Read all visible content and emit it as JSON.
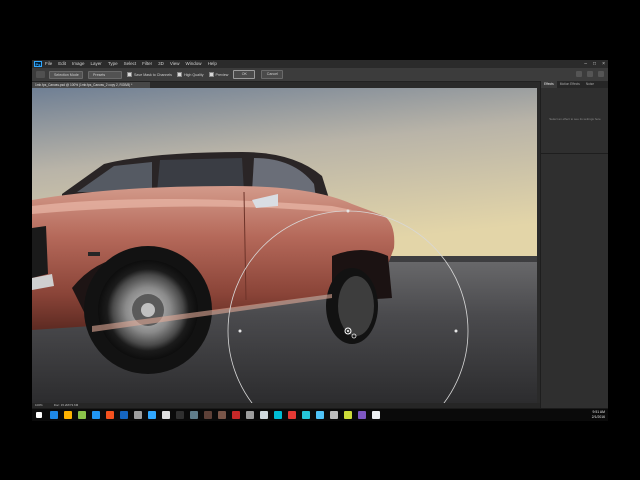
{
  "app": {
    "logo_text": "Ps",
    "menu": [
      "File",
      "Edit",
      "Image",
      "Layer",
      "Type",
      "Select",
      "Filter",
      "3D",
      "View",
      "Window",
      "Help"
    ],
    "window_controls": [
      "–",
      "□",
      "×"
    ]
  },
  "options_bar": {
    "selection_mode": "Selection Mode",
    "preset": "Presets",
    "save_mask_label": "Save Mask to Channels",
    "high_quality_label": "High Quality",
    "preview_label": "Preview",
    "ok_label": "OK",
    "cancel_label": "Cancel"
  },
  "document": {
    "tab_label": "1mb.fps_Canvas.psd @ 100% (1mb.fps_Canvas_2 copy 2, RGB/8) *",
    "zoom": "100%",
    "doc_size": "Doc: 15.2M/73.6M"
  },
  "panel": {
    "tabs": [
      "Effects",
      "Motion Effects",
      "Noise"
    ],
    "message": "Select an effect to see its settings here"
  },
  "taskbar": {
    "time": "9:51 AM",
    "date": "2/1/2016",
    "icon_colors": [
      "#1e88e5",
      "#ffb300",
      "#8bc34a",
      "#2196f3",
      "#f4511e",
      "#1565c0",
      "#9e9e9e",
      "#31a8ff",
      "#e0e0e0",
      "#2f2f2f",
      "#607d8b",
      "#5d4037",
      "#795548",
      "#c62828",
      "#9e9e9e",
      "#cfd8dc",
      "#00bcd4",
      "#e53935",
      "#26c6da",
      "#4fc3f7",
      "#bdbdbd",
      "#cddc39",
      "#7e57c2",
      "#eceff1"
    ]
  },
  "colors": {
    "car_body": "#b56657",
    "sky_top": "#7d8796",
    "sky_bottom": "#dccfa4",
    "ground": "#4a4a4c"
  }
}
